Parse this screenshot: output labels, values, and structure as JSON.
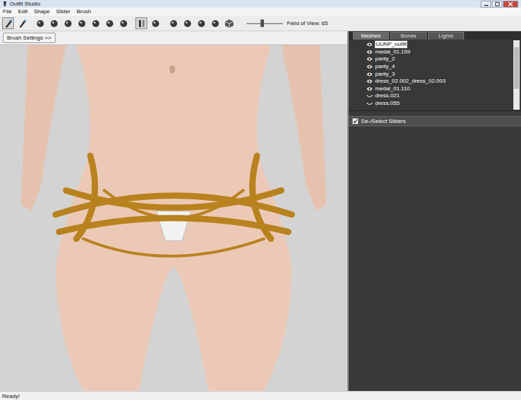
{
  "window": {
    "title": "Outfit Studio"
  },
  "menu": [
    "File",
    "Edit",
    "Shape",
    "Slider",
    "Brush"
  ],
  "toolbar": {
    "tools": [
      {
        "selected": true
      },
      {
        "selected": false
      },
      {
        "selected": false
      },
      {
        "selected": false
      },
      {
        "selected": false
      },
      {
        "selected": false
      },
      {
        "selected": false
      },
      {
        "selected": false
      },
      {
        "selected": false
      },
      {
        "selected": true
      },
      {
        "selected": false
      },
      {
        "selected": false
      },
      {
        "selected": false
      },
      {
        "selected": false
      },
      {
        "selected": false
      },
      {
        "selected": false
      }
    ],
    "fov": {
      "label": "Field of View: 65",
      "level": 0.42
    }
  },
  "brush_settings": "Brush Settings >>",
  "tabs": [
    {
      "label": "Meshes",
      "selected": true
    },
    {
      "label": "Bones",
      "selected": false
    },
    {
      "label": "Lights",
      "selected": false
    }
  ],
  "meshes": [
    {
      "name": "UUNP_outfit",
      "visible": true,
      "selected": true
    },
    {
      "name": "medal_01.159",
      "visible": true,
      "selected": false
    },
    {
      "name": "panty_2",
      "visible": true,
      "selected": false
    },
    {
      "name": "panty_4",
      "visible": true,
      "selected": false
    },
    {
      "name": "panty_3",
      "visible": true,
      "selected": false
    },
    {
      "name": "dress_02.002_dress_02.003",
      "visible": true,
      "selected": false
    },
    {
      "name": "medal_01.110",
      "visible": true,
      "selected": false
    },
    {
      "name": "dress.021",
      "visible": false,
      "selected": false
    },
    {
      "name": "dress.055",
      "visible": false,
      "selected": false
    }
  ],
  "sliders": {
    "label": "De-/Select Sliders",
    "checked": true
  },
  "status_bar": "Ready!"
}
